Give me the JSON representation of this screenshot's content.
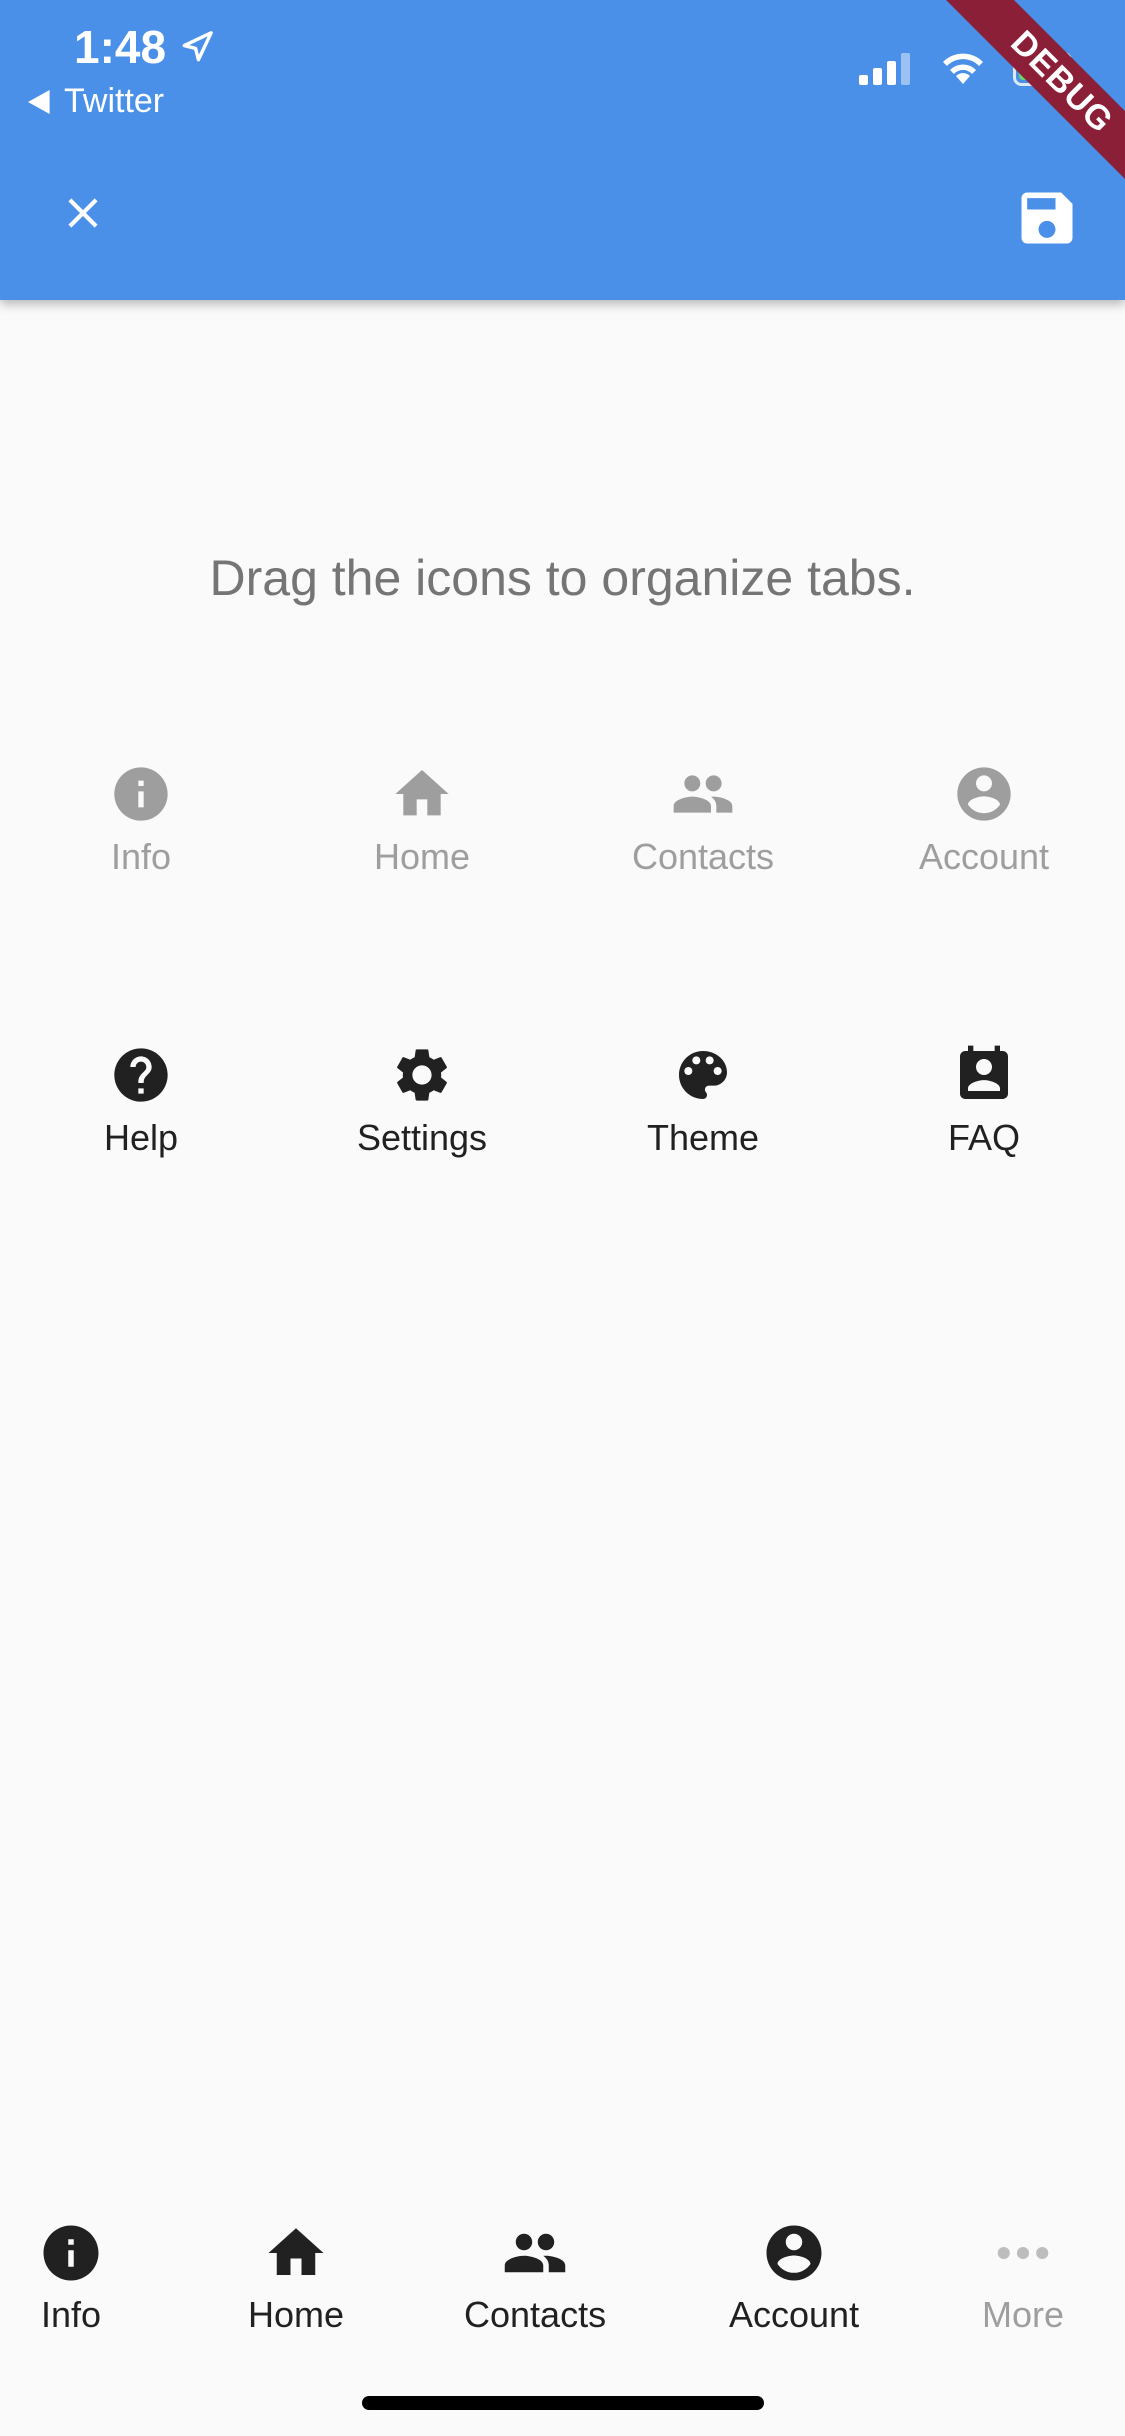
{
  "status_bar": {
    "time": "1:48",
    "back_app": "Twitter"
  },
  "debug_banner": "DEBUG",
  "instruction": "Drag the icons to organize tabs.",
  "active_tabs": [
    {
      "label": "Info",
      "icon": "info-icon"
    },
    {
      "label": "Home",
      "icon": "home-icon"
    },
    {
      "label": "Contacts",
      "icon": "contacts-icon"
    },
    {
      "label": "Account",
      "icon": "account-icon"
    }
  ],
  "available_tabs": [
    {
      "label": "Help",
      "icon": "help-icon"
    },
    {
      "label": "Settings",
      "icon": "settings-icon"
    },
    {
      "label": "Theme",
      "icon": "palette-icon"
    },
    {
      "label": "FAQ",
      "icon": "faq-icon"
    }
  ],
  "bottom_nav": [
    {
      "label": "Info",
      "icon": "info-icon"
    },
    {
      "label": "Home",
      "icon": "home-icon"
    },
    {
      "label": "Contacts",
      "icon": "contacts-icon"
    },
    {
      "label": "Account",
      "icon": "account-icon"
    },
    {
      "label": "More",
      "icon": "more-icon"
    }
  ],
  "colors": {
    "app_bar": "#4a90e8",
    "debug_ribbon": "#8b1f38",
    "inactive": "#9e9e9e",
    "active": "#212121",
    "background": "#fafafa"
  }
}
